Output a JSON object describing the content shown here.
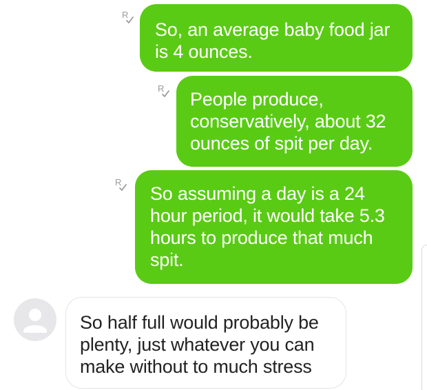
{
  "theme": {
    "accent": "#5acb14"
  },
  "conversation": {
    "messages": [
      {
        "direction": "outgoing",
        "text": "So, an average baby food jar\nis 4 ounces.",
        "status_icon": "read-receipt-icon"
      },
      {
        "direction": "outgoing",
        "text": "People produce,\nconservatively, about 32\nounces of spit per day.",
        "status_icon": "read-receipt-icon"
      },
      {
        "direction": "outgoing",
        "text": "So assuming a day is a 24\nhour period, it would take 5.3\nhours to produce that much\nspit.",
        "status_icon": "read-receipt-icon"
      },
      {
        "direction": "incoming",
        "text": "So half full would probably be\nplenty, just whatever you can\nmake without to much stress",
        "avatar_icon": "default-avatar-icon"
      }
    ]
  }
}
